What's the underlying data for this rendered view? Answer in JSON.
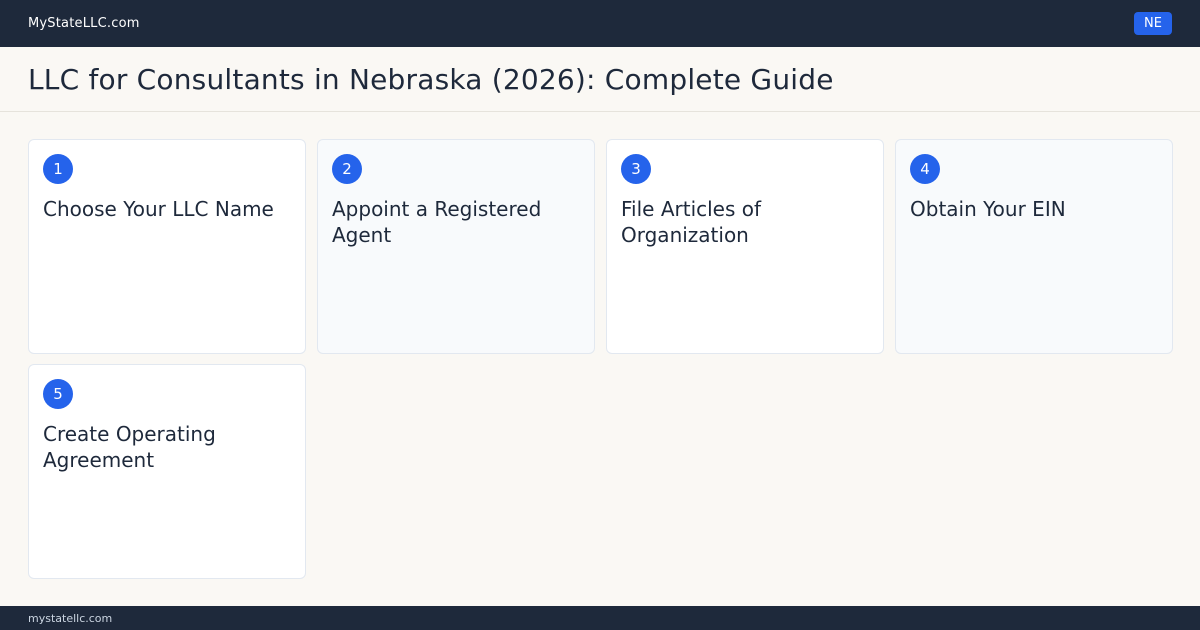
{
  "header": {
    "brand": "MyStateLLC.com",
    "state_badge": "NE"
  },
  "page": {
    "title": "LLC for Consultants in Nebraska (2026): Complete Guide"
  },
  "steps": [
    {
      "number": "1",
      "title": "Choose Your LLC Name"
    },
    {
      "number": "2",
      "title": "Appoint a Registered Agent"
    },
    {
      "number": "3",
      "title": "File Articles of Organization"
    },
    {
      "number": "4",
      "title": "Obtain Your EIN"
    },
    {
      "number": "5",
      "title": "Create Operating Agreement"
    }
  ],
  "footer": {
    "domain": "mystatellc.com"
  },
  "colors": {
    "header_bg": "#1e293b",
    "accent": "#2563eb",
    "page_bg": "#faf8f4"
  }
}
